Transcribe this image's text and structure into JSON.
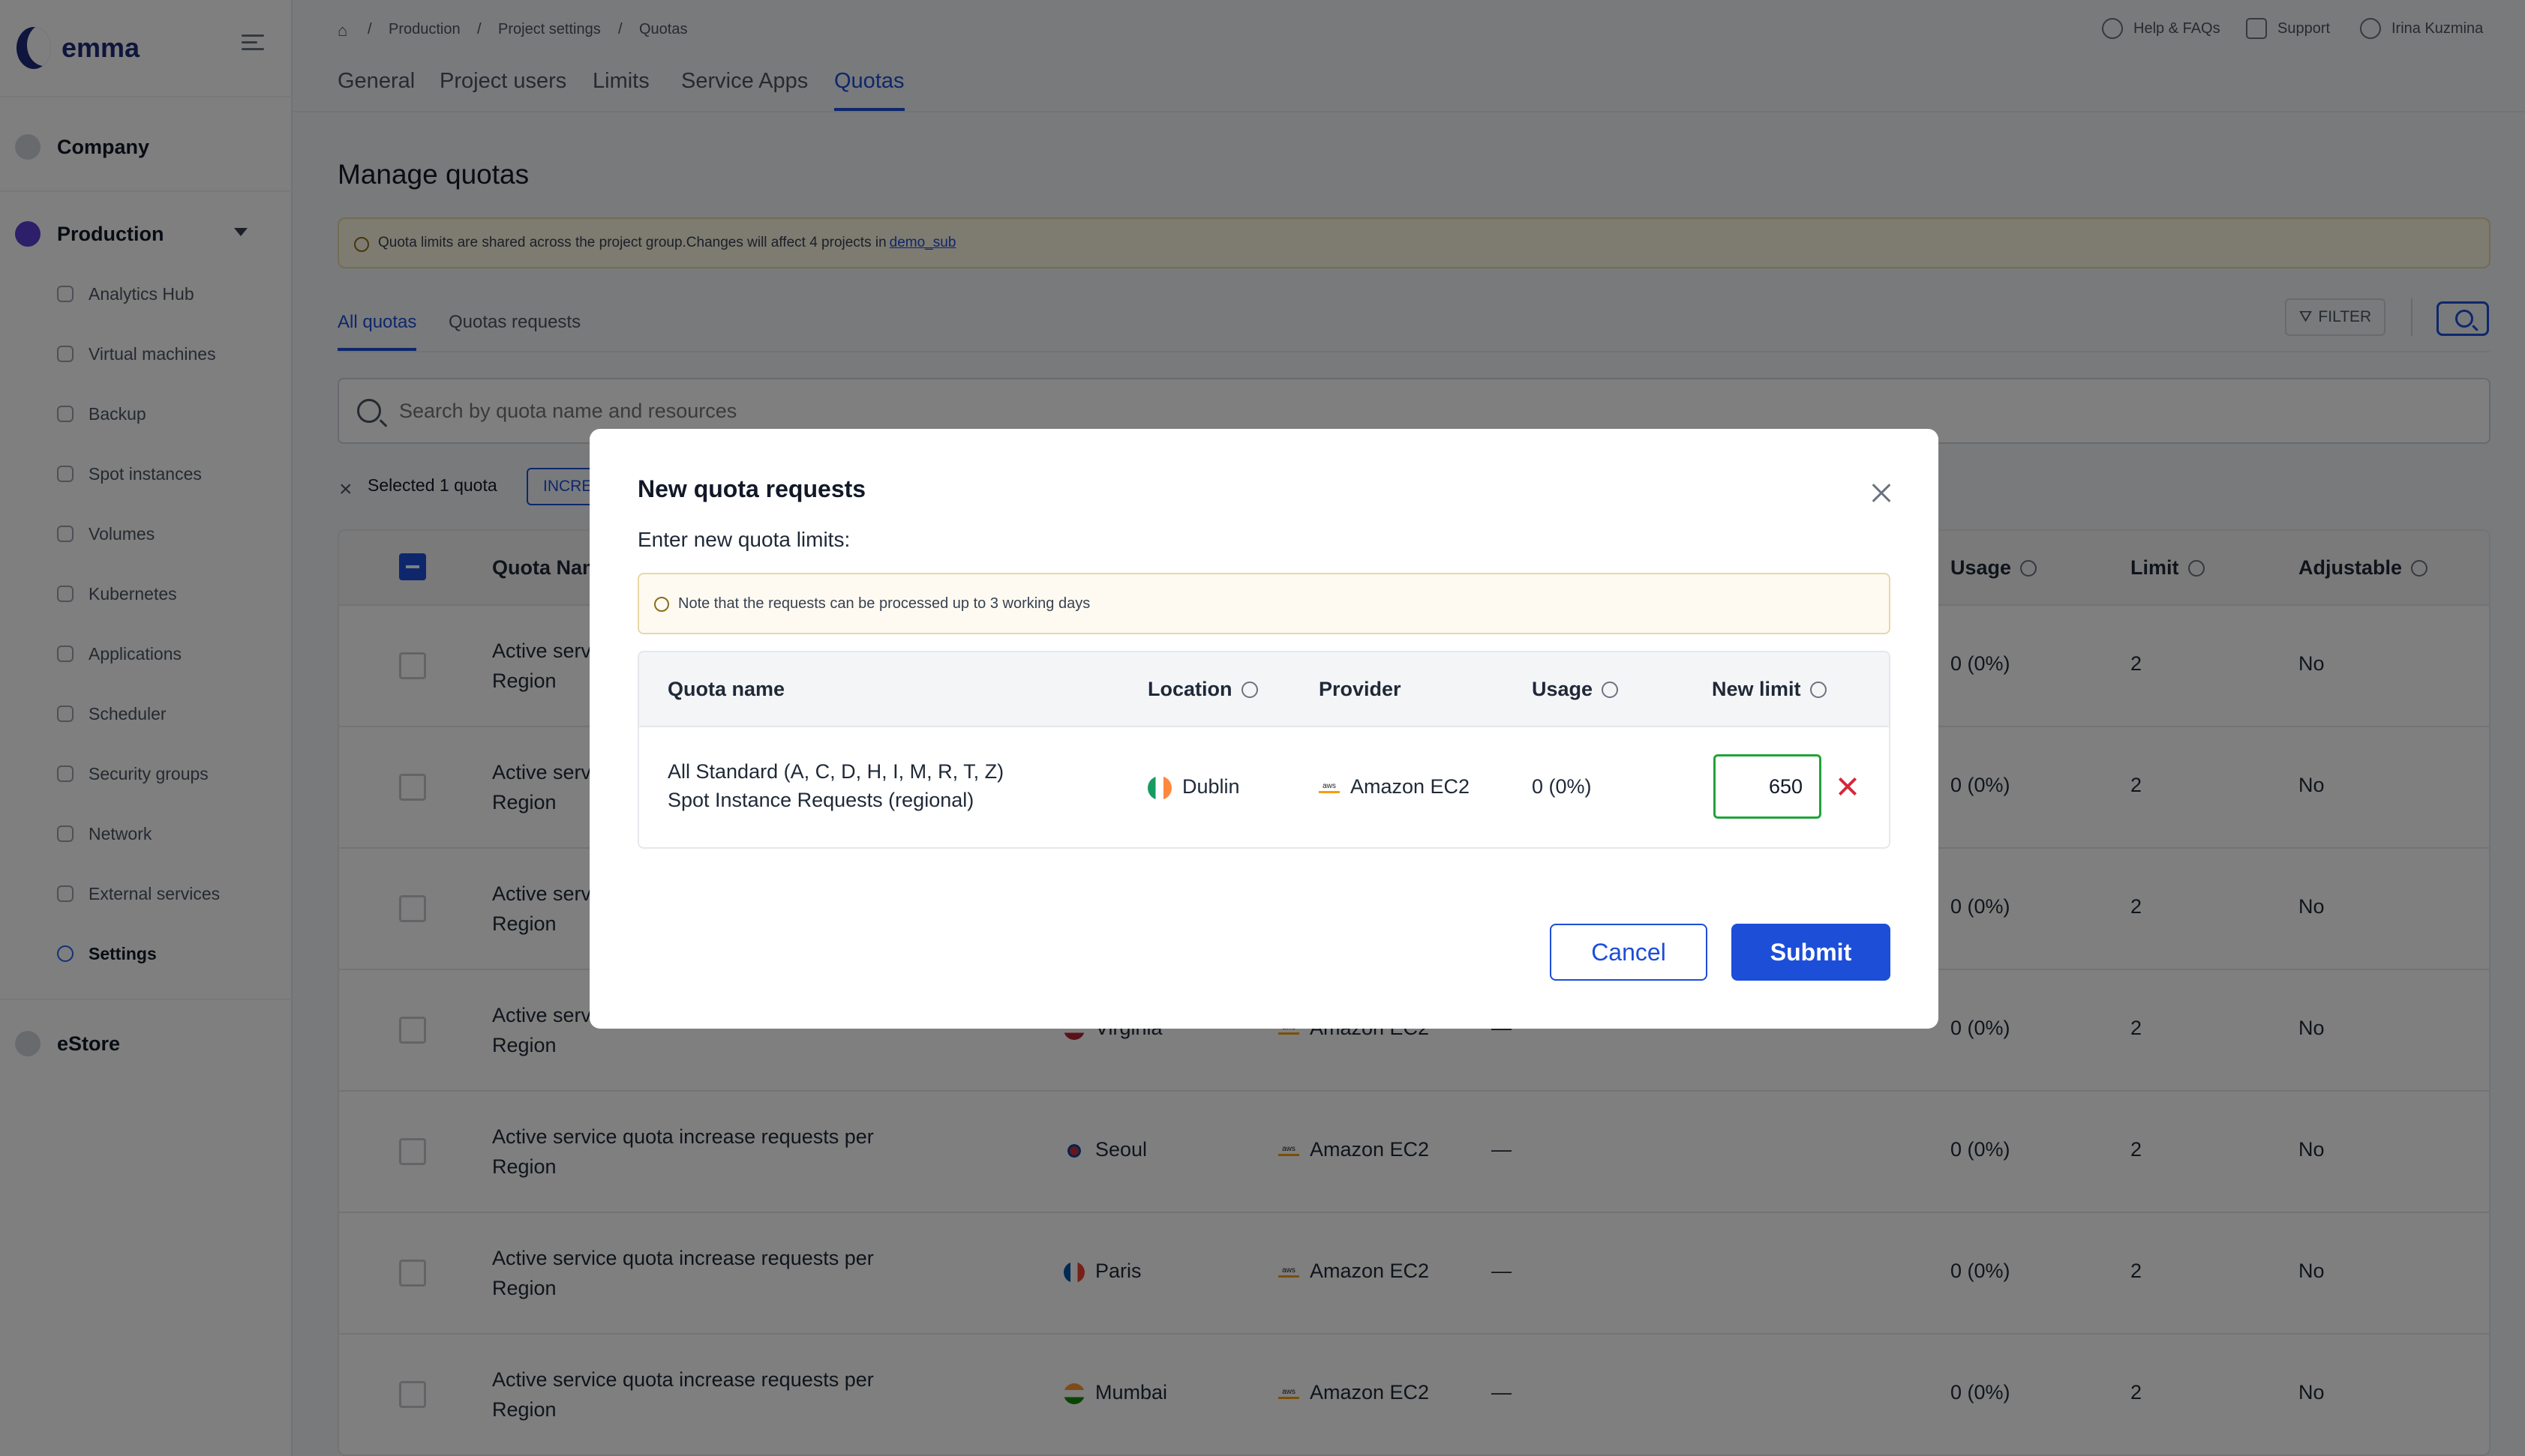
{
  "brand": {
    "name": "emma"
  },
  "sidebar": {
    "groups": {
      "company": "Company",
      "production": "Production",
      "estore": "eStore"
    },
    "items": [
      {
        "label": "Analytics Hub",
        "icon": "dashboard-icon"
      },
      {
        "label": "Virtual machines",
        "icon": "server-icon"
      },
      {
        "label": "Backup",
        "icon": "history-icon"
      },
      {
        "label": "Spot instances",
        "icon": "clock-icon"
      },
      {
        "label": "Volumes",
        "icon": "drive-icon"
      },
      {
        "label": "Kubernetes",
        "icon": "kubernetes-icon"
      },
      {
        "label": "Applications",
        "icon": "cube-icon"
      },
      {
        "label": "Scheduler",
        "icon": "calendar-icon"
      },
      {
        "label": "Security groups",
        "icon": "shield-icon"
      },
      {
        "label": "Network",
        "icon": "network-icon"
      },
      {
        "label": "External services",
        "icon": "plug-icon"
      },
      {
        "label": "Settings",
        "icon": "gear-icon",
        "active": true
      }
    ]
  },
  "breadcrumb": [
    "Production",
    "Project settings",
    "Quotas"
  ],
  "top_links": {
    "help": "Help & FAQs",
    "support": "Support",
    "user": "Irina Kuzmina"
  },
  "tabs": [
    "General",
    "Project users",
    "Limits",
    "Service Apps",
    "Quotas"
  ],
  "active_tab": "Quotas",
  "page_title": "Manage quotas",
  "banner": {
    "text": "Quota limits are shared across the project group.Changes will affect 4 projects in",
    "link": "demo_sub"
  },
  "subtabs": [
    "All quotas",
    "Quotas requests"
  ],
  "filter_label": "FILTER",
  "search": {
    "placeholder": "Search by quota name and resources"
  },
  "selection": {
    "text": "Selected 1 quota",
    "action": "INCREASE"
  },
  "table": {
    "columns": {
      "name": "Quota Name",
      "usage": "Usage",
      "limit": "Limit",
      "adjustable": "Adjustable"
    },
    "rows": [
      {
        "name": "Active service quota increase requests per Region",
        "location": "",
        "provider": "",
        "applied": "",
        "usage": "0 (0%)",
        "limit": "2",
        "adjustable": "No"
      },
      {
        "name": "Active service quota increase requests per Region",
        "location": "",
        "provider": "",
        "applied": "",
        "usage": "0 (0%)",
        "limit": "2",
        "adjustable": "No"
      },
      {
        "name": "Active service quota increase requests per Region",
        "location": "",
        "provider": "",
        "applied": "",
        "usage": "0 (0%)",
        "limit": "2",
        "adjustable": "No"
      },
      {
        "name": "Active service quota increase requests per Region",
        "location": "Virginia",
        "provider": "Amazon EC2",
        "applied": "—",
        "usage": "0 (0%)",
        "limit": "2",
        "adjustable": "No"
      },
      {
        "name": "Active service quota increase requests per Region",
        "location": "Seoul",
        "provider": "Amazon EC2",
        "applied": "—",
        "usage": "0 (0%)",
        "limit": "2",
        "adjustable": "No"
      },
      {
        "name": "Active service quota increase requests per Region",
        "location": "Paris",
        "provider": "Amazon EC2",
        "applied": "—",
        "usage": "0 (0%)",
        "limit": "2",
        "adjustable": "No"
      },
      {
        "name": "Active service quota increase requests per Region",
        "location": "Mumbai",
        "provider": "Amazon EC2",
        "applied": "—",
        "usage": "0 (0%)",
        "limit": "2",
        "adjustable": "No"
      }
    ]
  },
  "modal": {
    "title": "New quota requests",
    "subtitle": "Enter new quota limits:",
    "note": "Note that the requests can be processed up to 3 working days",
    "columns": {
      "name": "Quota name",
      "location": "Location",
      "provider": "Provider",
      "usage": "Usage",
      "new_limit": "New limit"
    },
    "row": {
      "name_line1": "All Standard (A, C, D, H, I, M, R, T, Z)",
      "name_line2": "Spot Instance Requests (regional)",
      "location": "Dublin",
      "provider": "Amazon EC2",
      "usage": "0 (0%)",
      "new_limit": "650"
    },
    "cancel": "Cancel",
    "submit": "Submit"
  },
  "colors": {
    "accent": "#1d4ed8",
    "valid": "#22a33a",
    "danger": "#d62839",
    "banner_bg": "#fdf6e3"
  }
}
